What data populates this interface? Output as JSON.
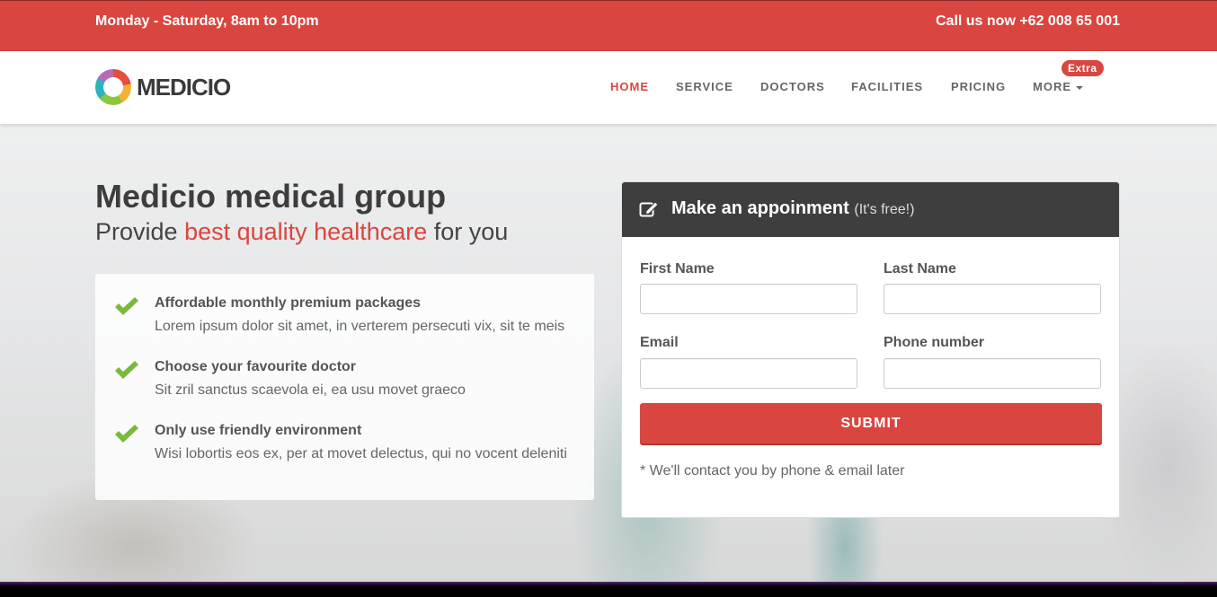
{
  "topbar": {
    "hours": "Monday - Saturday, 8am to 10pm",
    "call": "Call us now +62 008 65 001"
  },
  "brand": {
    "logo_text": "MEDICIO"
  },
  "nav": {
    "items": [
      "HOME",
      "SERVICE",
      "DOCTORS",
      "FACILITIES",
      "PRICING",
      "MORE"
    ],
    "active": "HOME",
    "badge": "Extra"
  },
  "hero": {
    "title": "Medicio medical group",
    "subtitle_before": "Provide ",
    "subtitle_highlight": "best quality healthcare",
    "subtitle_after": " for you"
  },
  "features": [
    {
      "title": "Affordable monthly premium packages",
      "desc": "Lorem ipsum dolor sit amet, in verterem persecuti vix, sit te meis"
    },
    {
      "title": "Choose your favourite doctor",
      "desc": "Sit zril sanctus scaevola ei, ea usu movet graeco"
    },
    {
      "title": "Only use friendly environment",
      "desc": "Wisi lobortis eos ex, per at movet delectus, qui no vocent deleniti"
    }
  ],
  "appointment": {
    "title": "Make an appoinment",
    "subtitle": "(It's free!)",
    "fields": {
      "first_name": {
        "label": "First Name",
        "value": ""
      },
      "last_name": {
        "label": "Last Name",
        "value": ""
      },
      "email": {
        "label": "Email",
        "value": ""
      },
      "phone": {
        "label": "Phone number",
        "value": ""
      }
    },
    "submit": "SUBMIT",
    "note": "* We'll contact you by phone & email later"
  },
  "colors": {
    "accent": "#d9463f",
    "check": "#7cb83e",
    "form_header": "#3e3e3e"
  }
}
